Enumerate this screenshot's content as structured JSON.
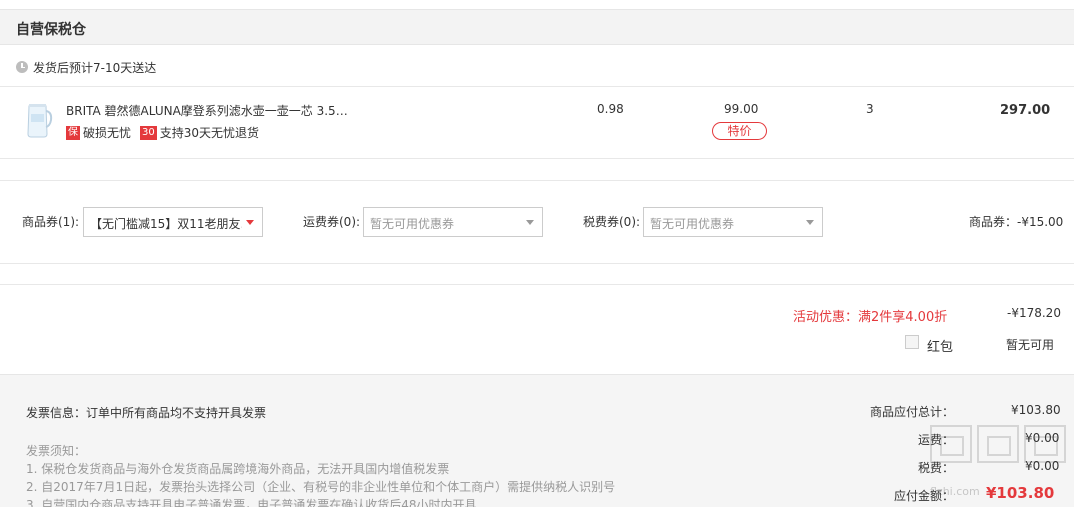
{
  "header": {
    "title": "自营保税仓"
  },
  "delivery": {
    "text": "发货后预计7-10天送达"
  },
  "item": {
    "name": "BRITA 碧然德ALUNA摩登系列滤水壶一壶一芯 3.5…",
    "badge1": "保",
    "service1": "破损无忧",
    "badge2": "30",
    "service2": "支持30天无忧退货",
    "col_a": "0.98",
    "price": "99.00",
    "tag": "特价",
    "qty": "3",
    "total": "297.00"
  },
  "coupons": {
    "goods_label": "商品券(1):",
    "goods_value": "【无门槛减15】双11老朋友…",
    "shipping_label": "运费券(0):",
    "shipping_value": "暂无可用优惠券",
    "tax_label": "税费券(0):",
    "tax_value": "暂无可用优惠券",
    "summary": "商品券：-¥15.00"
  },
  "promo": {
    "label": "活动优惠：满2件享4.00折",
    "value": "-¥178.20",
    "redpacket_label": "红包",
    "redpacket_value": "暂无可用"
  },
  "invoice": {
    "info": "发票信息：订单中所有商品均不支持开具发票",
    "notice_title": "发票须知：",
    "notice_1": "1. 保税仓发货商品与海外仓发货商品属跨境海外商品，无法开具国内增值税发票",
    "notice_2": "2. 自2017年7月1日起，发票抬头选择公司（企业、有税号的非企业性单位和个体工商户）需提供纳税人识别号",
    "notice_3": "3. 自营国内仓商品支持开具电子普通发票，电子普通发票在确认收货后48小时内开具"
  },
  "summary": {
    "subtotal_label": "商品应付总计：",
    "subtotal_value": "¥103.80",
    "shipping_label": "运费：",
    "shipping_value": "¥0.00",
    "tax_label": "税费：",
    "tax_value": "¥0.00",
    "due_label": "应付金额：",
    "due_value": "¥103.80"
  },
  "watermark": {
    "text": "flzhi.com"
  },
  "colors": {
    "accent": "#e4393c",
    "muted": "#999999",
    "panel": "#f5f5f5"
  }
}
